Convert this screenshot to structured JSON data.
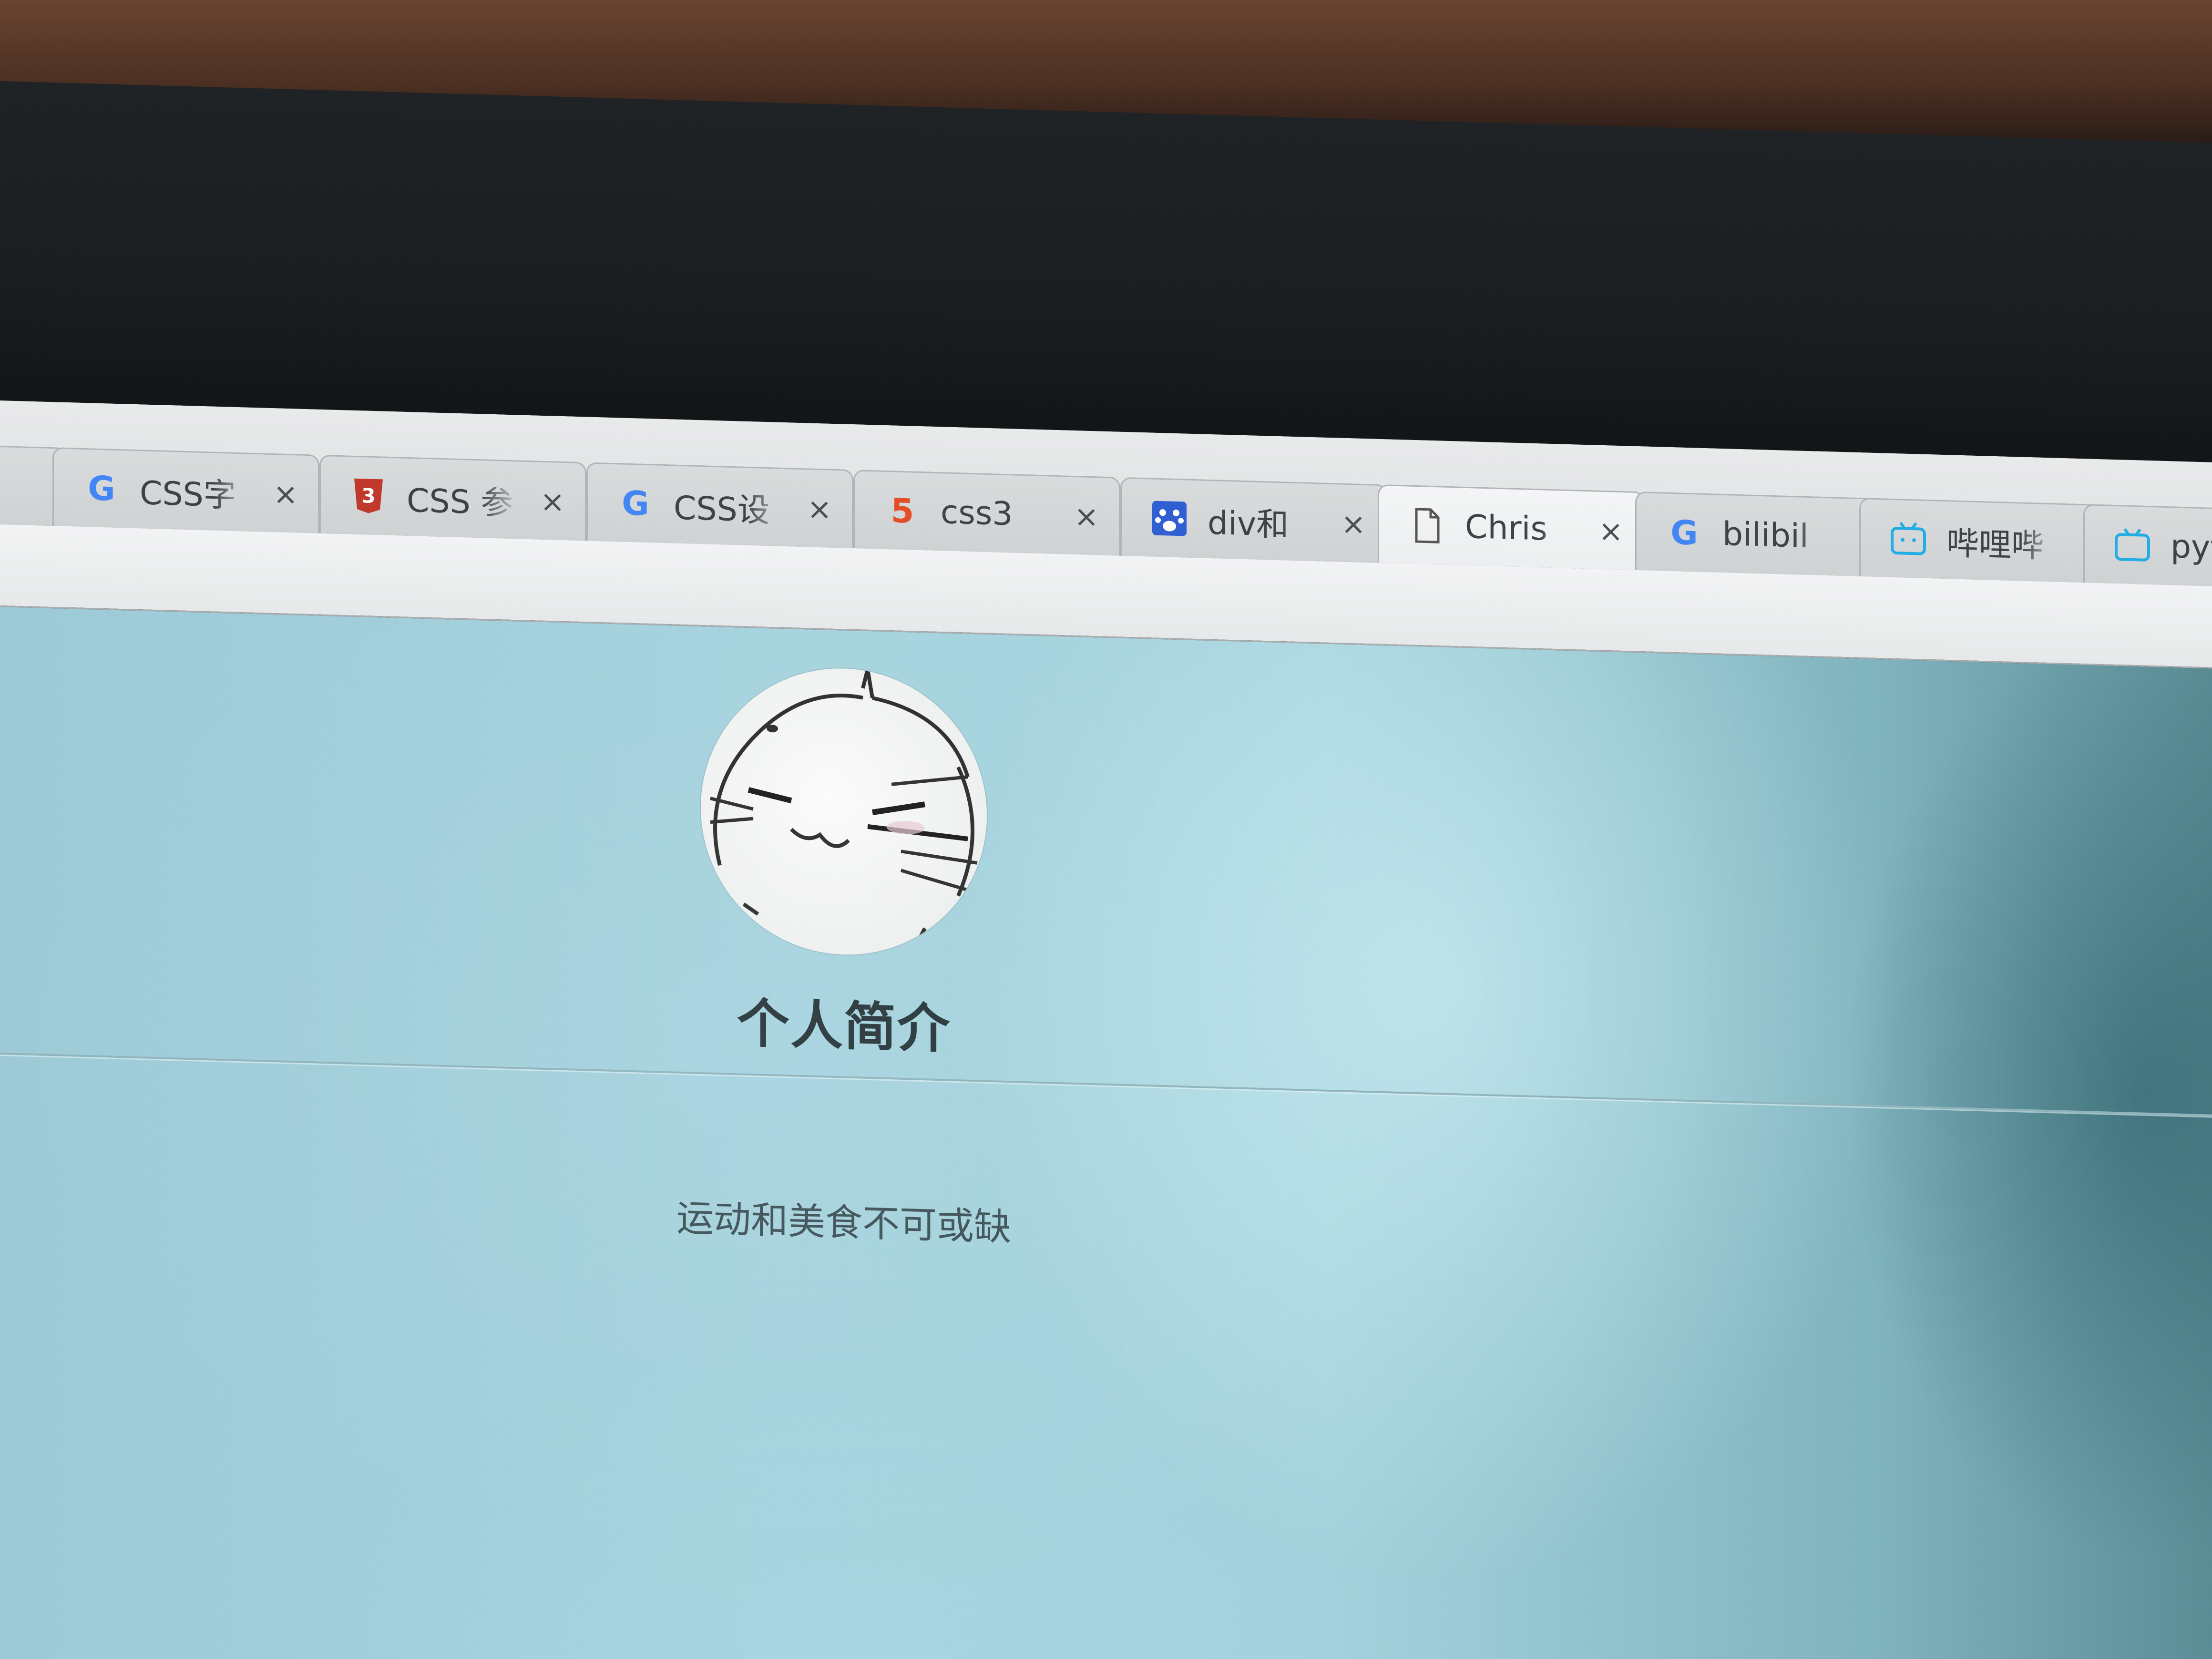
{
  "browser": {
    "tabs": [
      {
        "title": "CSS字",
        "favicon": "google-icon",
        "color": "#4285f4"
      },
      {
        "title": "CSS 参",
        "favicon": "w3-icon",
        "color": "#c0392b"
      },
      {
        "title": "CSS设",
        "favicon": "google-icon",
        "color": "#4285f4"
      },
      {
        "title": "css3 ",
        "favicon": "html5-icon",
        "color": "#e44d26"
      },
      {
        "title": "div和",
        "favicon": "baidu-paw-icon",
        "color": "#2f5fd0"
      },
      {
        "title": "Chris",
        "favicon": "document-icon",
        "color": "#555555"
      },
      {
        "title": "bilibil",
        "favicon": "google-icon",
        "color": "#4285f4"
      },
      {
        "title": "哔哩哔",
        "favicon": "bilibili-tv-icon",
        "color": "#23ade5"
      },
      {
        "title": "pytho",
        "favicon": "bilibili-tv-icon",
        "color": "#23ade5"
      }
    ],
    "active_tab_index": 5,
    "close_glyph": "×"
  },
  "profile": {
    "title": "个人简介",
    "description": "运动和美食不可或缺",
    "avatar": "cat-face-avatar"
  },
  "colors": {
    "page_background": "#a6d3de",
    "title_text": "#27363a",
    "description_text": "#3e5257"
  }
}
